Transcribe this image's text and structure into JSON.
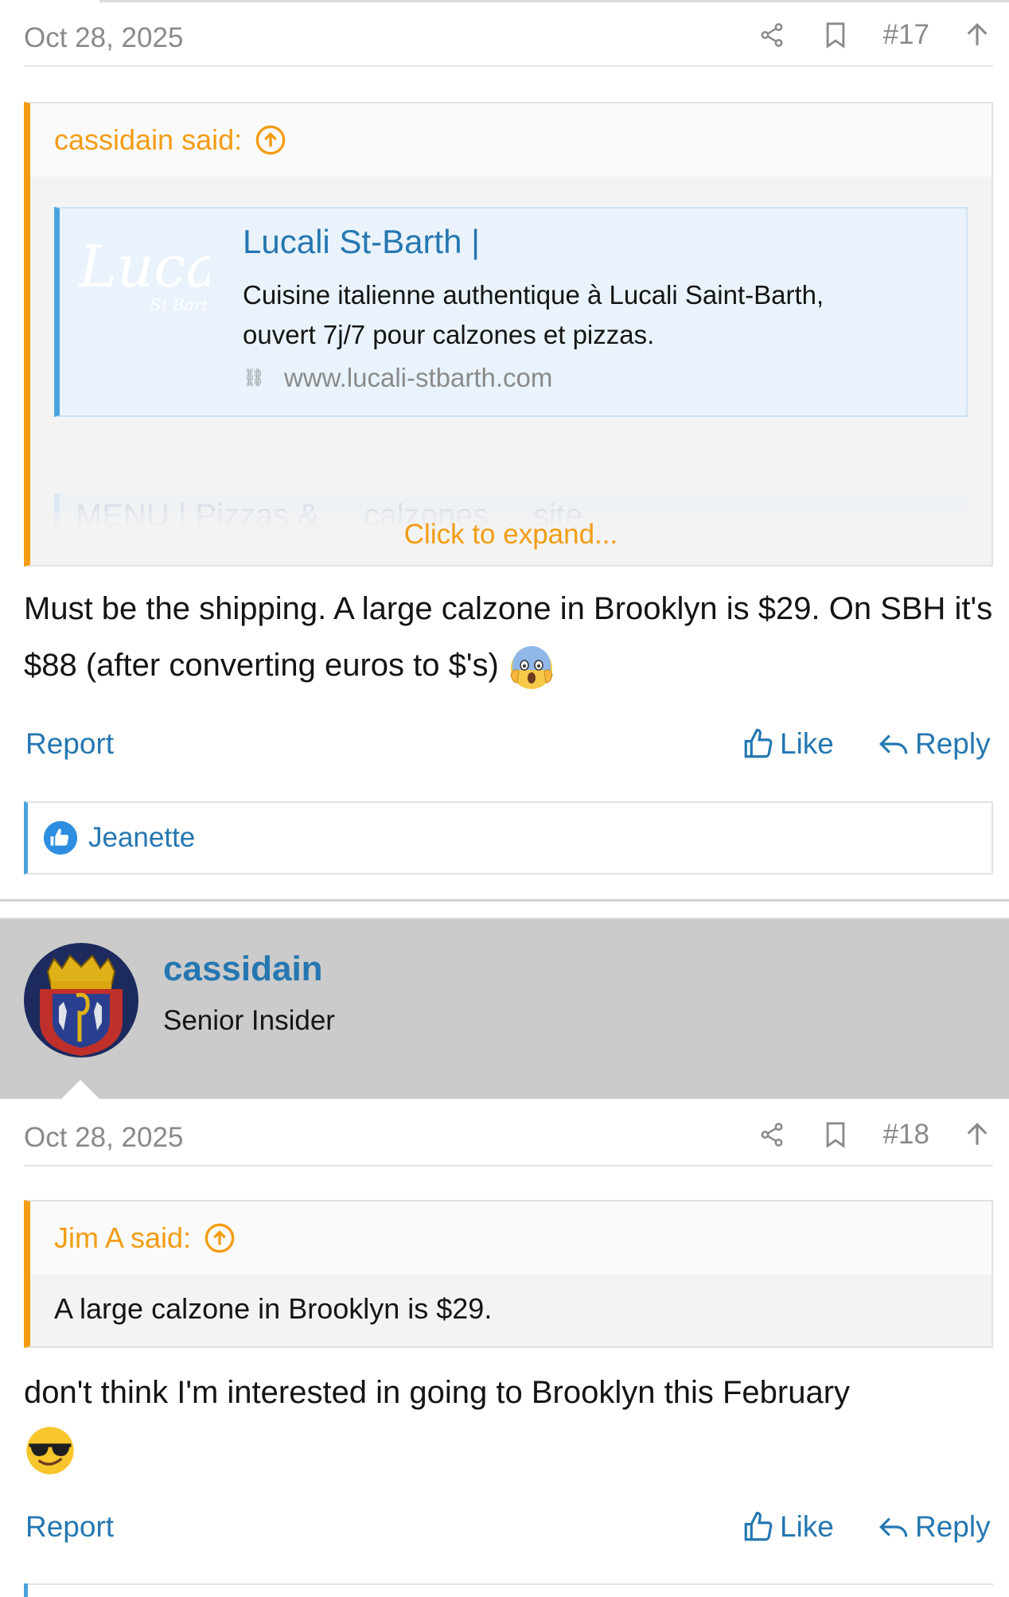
{
  "post17": {
    "date": "Oct 28, 2025",
    "number": "#17",
    "quote": {
      "author_said": "cassidain said:",
      "embed": {
        "logo_text": "Lucali",
        "logo_sub": "St Barth",
        "title": "Lucali St-Barth |",
        "description": "Cuisine italienne authentique à Lucali Saint-Barth, ouvert 7j/7 pour calzones et pizzas.",
        "url": "www.lucali-stbarth.com"
      },
      "faded_text": "MENU | Pizzas & ... calzones ... site",
      "expand_label": "Click to expand..."
    },
    "body": "Must be the shipping. A large calzone in Brooklyn is $29. On SBH it's $88 (after converting euros to $'s)",
    "emoji": "face-screaming-in-fear",
    "actions": {
      "report": "Report",
      "like": "Like",
      "reply": "Reply"
    },
    "reactions": {
      "user": "Jeanette"
    }
  },
  "author18": {
    "name": "cassidain",
    "title": "Senior Insider"
  },
  "post18": {
    "date": "Oct 28, 2025",
    "number": "#18",
    "quote": {
      "author_said": "Jim A said:",
      "text": "A large calzone in Brooklyn is $29."
    },
    "body": "don't think I'm interested in going to Brooklyn this February",
    "emoji": "smiling-face-with-sunglasses",
    "actions": {
      "report": "Report",
      "like": "Like",
      "reply": "Reply"
    }
  },
  "colors": {
    "accent_blue": "#2577b1",
    "quote_orange": "#f39c12",
    "muted": "#8a8a8a",
    "author_band": "#cbcbcb"
  }
}
